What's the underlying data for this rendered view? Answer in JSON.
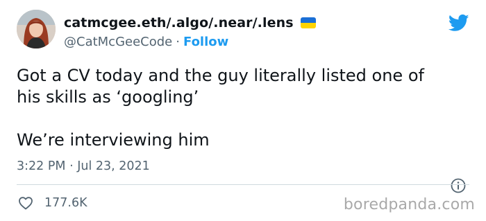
{
  "tweet": {
    "avatar_icon": "profile-photo",
    "display_name": "catmcgee.eth/.algo/.near/.lens",
    "flag_icon": "ukraine-flag-icon",
    "handle": "@CatMcGeeCode",
    "separator": "·",
    "follow_label": "Follow",
    "text_line1": "Got a CV today and the guy literally listed one of",
    "text_line2": "his skills as ‘googling’",
    "text_line3": "We’re interviewing him",
    "timestamp": "3:22 PM · Jul 23, 2021",
    "like_count": "177.6K",
    "accent_color": "#1d9bf0"
  },
  "watermark": "boredpanda.com"
}
